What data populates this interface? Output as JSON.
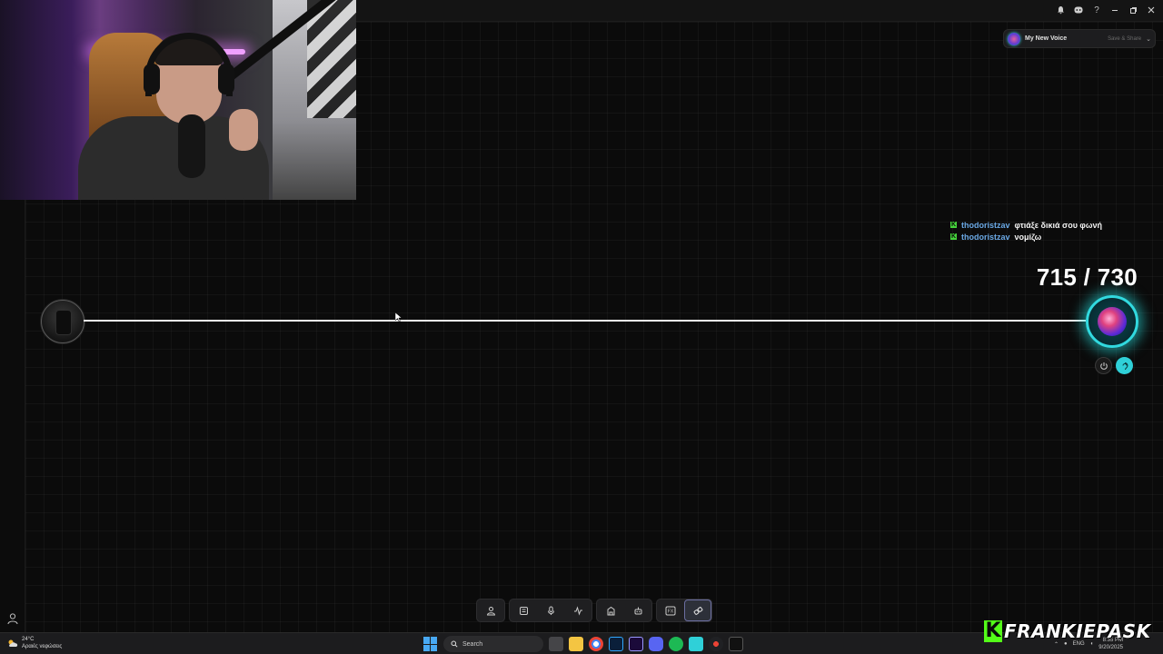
{
  "window": {
    "top_icons": [
      "bell-icon",
      "discord-icon",
      "help-icon",
      "minimize-icon",
      "maximize-icon",
      "close-icon"
    ],
    "help_glyph": "?"
  },
  "voice_selector": {
    "name": "My New Voice",
    "save_label": "Save & Share",
    "chevron": "⌄",
    "accent": "#2fd0d8"
  },
  "chat": [
    {
      "badge": "K",
      "user": "thodoristzav",
      "message": "φτιάξε δικιά σου φωνή"
    },
    {
      "badge": "K",
      "user": "thodoristzav",
      "message": "νομίζω"
    }
  ],
  "counter": {
    "value": "715 / 730"
  },
  "toolbar": {
    "groups": [
      [
        "user-icon"
      ],
      [
        "calculator-icon",
        "microphone-icon",
        "waveform-icon"
      ],
      [
        "building-icon",
        "robot-icon"
      ],
      [
        "fx-icon",
        "link-icon"
      ]
    ],
    "fx_label": "FX",
    "active": "link-icon"
  },
  "taskbar": {
    "weather_temp": "24°C",
    "weather_desc": "Αραιές νεφώσεις",
    "search_label": "Search",
    "language": "ENG",
    "time": "8:35 PM",
    "date": "9/20/2025"
  },
  "watermark": {
    "badge": "K",
    "text": "FRANKIEPASK",
    "color": "#53fc18"
  }
}
